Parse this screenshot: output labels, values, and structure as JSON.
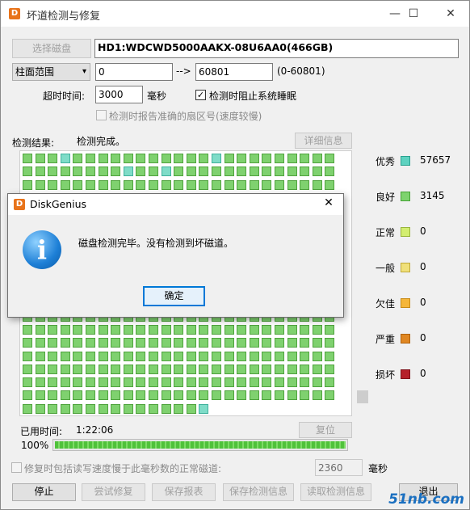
{
  "window": {
    "app_icon": "disk-genius-logo",
    "title": "坏道检测与修复",
    "minimize": "—",
    "maximize": "☐",
    "close": "✕"
  },
  "top": {
    "select_disk": "选择磁盘",
    "disk_name": "HD1:WDCWD5000AAKX-08U6AA0(466GB)",
    "range_type": "柱面范围",
    "range_start": "0",
    "arrow": "-->",
    "range_end": "60801",
    "range_hint": "(0-60801)",
    "timeout_label": "超时时间:",
    "timeout_value": "3000",
    "timeout_unit": "毫秒",
    "prevent_sleep_checked": "✓",
    "prevent_sleep_label": "检测时阻止系统睡眠",
    "report_sector_label": "检测时报告准确的扇区号(速度较慢)"
  },
  "result": {
    "label": "检测结果:",
    "status": "检测完成。",
    "details": "详细信息"
  },
  "legend": [
    {
      "label": "优秀",
      "color": "#5ed2c0",
      "border": "#2aa28f",
      "value": "57657"
    },
    {
      "label": "良好",
      "color": "#7ed36e",
      "border": "#46a236",
      "value": "3145"
    },
    {
      "label": "正常",
      "color": "#d3ee70",
      "border": "#98b43a",
      "value": "0"
    },
    {
      "label": "一般",
      "color": "#f0e07a",
      "border": "#c0a93a",
      "value": "0"
    },
    {
      "label": "欠佳",
      "color": "#f5b63a",
      "border": "#c78a16",
      "value": "0"
    },
    {
      "label": "严重",
      "color": "#e08722",
      "border": "#b0620c",
      "value": "0"
    },
    {
      "label": "损坏",
      "color": "#b5202a",
      "border": "#7e1018",
      "value": "0"
    }
  ],
  "bottom": {
    "elapsed_label": "已用时间:",
    "elapsed_value": "1:22:06",
    "reset": "复位",
    "percent": "100%",
    "progress": 1.0,
    "repair_label": "修复时包括读写速度慢于此毫秒数的正常磁道:",
    "repair_value": "2360",
    "repair_unit": "毫秒",
    "stop": "停止",
    "try_repair": "尝试修复",
    "save_report": "保存报表",
    "save_info": "保存检测信息",
    "load_info": "读取检测信息",
    "exit": "退出"
  },
  "dialog": {
    "title": "DiskGenius",
    "close": "✕",
    "icon": "info-icon",
    "message": "磁盘检测完毕。没有检测到坏磁道。",
    "ok": "确定"
  },
  "watermark": "51nb.com"
}
